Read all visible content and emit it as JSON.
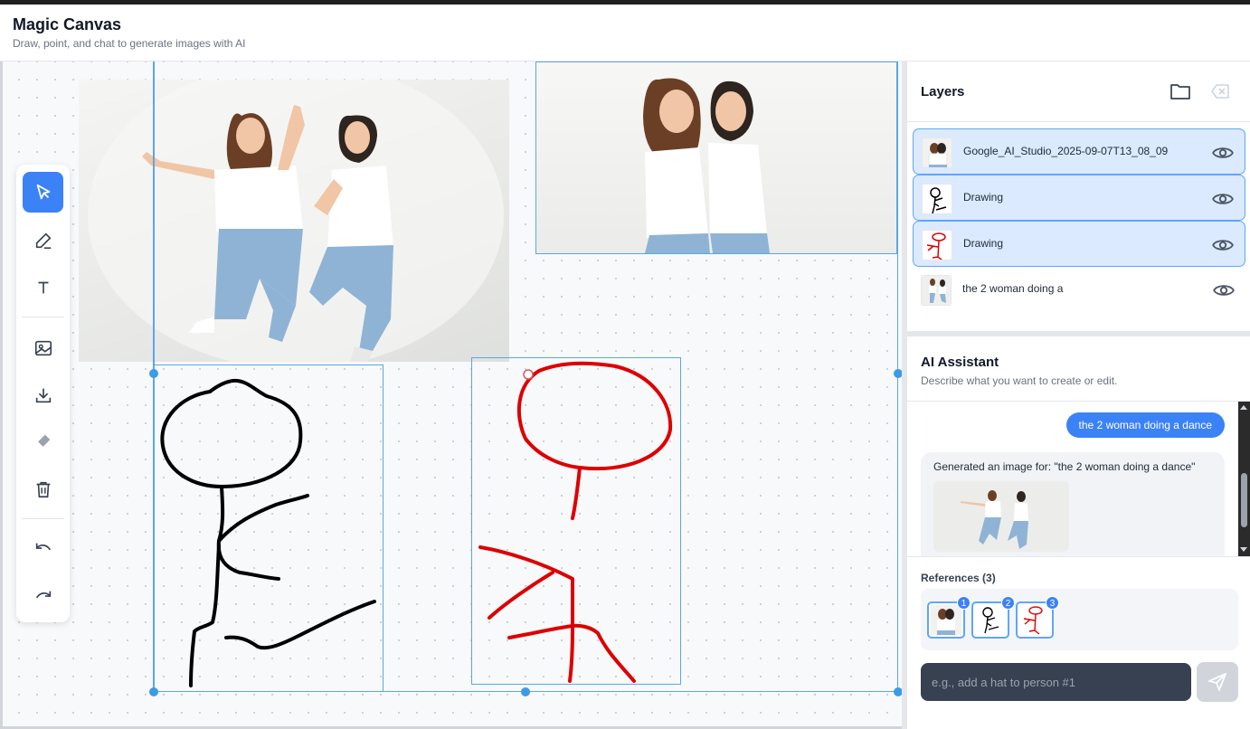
{
  "app": {
    "title": "Magic Canvas",
    "subtitle": "Draw, point, and chat to generate images with AI"
  },
  "toolbar": {
    "tools": [
      "select-tool",
      "pen-tool",
      "text-tool",
      "add-image",
      "download",
      "eraser",
      "delete",
      "undo",
      "redo"
    ],
    "active": "select-tool"
  },
  "layers": {
    "title": "Layers",
    "items": [
      {
        "name": "Google_AI_Studio_2025-09-07T13_08_09",
        "selected": true
      },
      {
        "name": "Drawing",
        "selected": true
      },
      {
        "name": "Drawing",
        "selected": true
      },
      {
        "name": "the 2 woman doing a",
        "selected": false
      }
    ]
  },
  "assistant": {
    "title": "AI Assistant",
    "subtitle": "Describe what you want to create or edit.",
    "user_message": "the 2 woman doing a dance",
    "bot_message": "Generated an image for: \"the 2 woman doing a dance\""
  },
  "references": {
    "title": "References (3)",
    "badges": [
      "1",
      "2",
      "3"
    ]
  },
  "prompt": {
    "placeholder": "e.g., add a hat to person #1"
  },
  "colors": {
    "accent": "#3b82f6",
    "selection": "#5aa6e8",
    "stroke_black": "#000000",
    "stroke_red": "#dd0000"
  }
}
